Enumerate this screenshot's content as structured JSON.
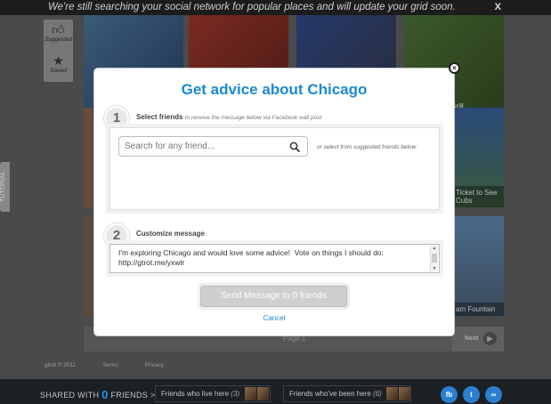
{
  "banner": {
    "message": "We're still searching your social network for popular places and will update your grid soon.",
    "close_label": "X"
  },
  "side_tools": [
    {
      "label": "Suggested",
      "icon": "thumbs-up-icon"
    },
    {
      "label": "Saved",
      "icon": "star-icon"
    }
  ],
  "tutorial_tab": "TUTORIAL",
  "tiles": [
    {
      "caption": ""
    },
    {
      "caption": ""
    },
    {
      "caption": ""
    },
    {
      "caption": "r & Grill"
    },
    {
      "caption": "Ticket to See Cubs"
    },
    {
      "caption": "am Fountain"
    }
  ],
  "pager": {
    "page_label": "Page 1",
    "next_label": "Next"
  },
  "footer": {
    "copyright": "gtrot © 2011",
    "terms": "Terms",
    "privacy": "Privacy"
  },
  "bottom_bar": {
    "shared_prefix": "SHARED WITH",
    "shared_count": "0",
    "shared_suffix": "FRIENDS >",
    "live_here_label": "Friends who live here",
    "live_here_count": "(3)",
    "been_here_label": "Friends who've been here",
    "been_here_count": "(6)",
    "social": [
      {
        "name": "facebook-icon",
        "glyph": "fb"
      },
      {
        "name": "twitter-icon",
        "glyph": "t"
      },
      {
        "name": "link-icon",
        "glyph": "∞"
      }
    ]
  },
  "modal": {
    "title": "Get advice about Chicago",
    "step1": {
      "number": "1",
      "label": "Select friends",
      "sublabel": "to receive the message below via Facebook wall post",
      "search_placeholder": "Search for any friend...",
      "hint": "or select from suggested friends below"
    },
    "step2": {
      "number": "2",
      "label": "Customize message",
      "message": "I'm exploring Chicago and would love some advice!  Vote on things I should do: http://gtrot.me/yxwlr"
    },
    "send_label": "Send Message to 0 friends",
    "cancel_label": "Cancel",
    "close_glyph": "×"
  }
}
